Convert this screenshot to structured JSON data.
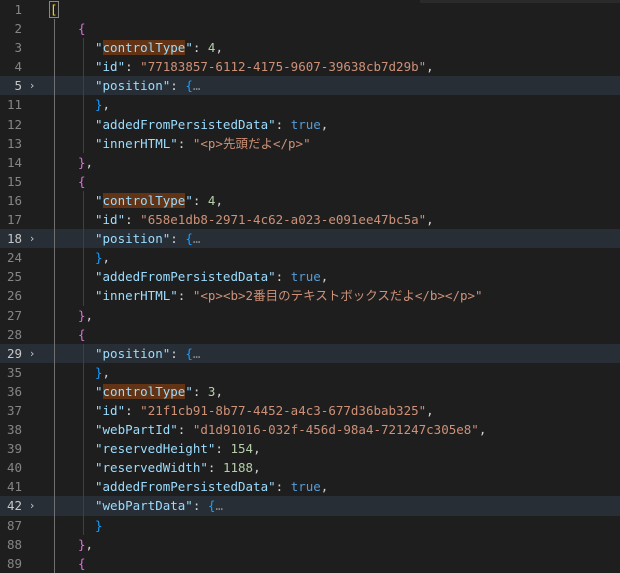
{
  "editor": {
    "lines": [
      {
        "num": "1",
        "fold": "",
        "hl": false,
        "indent": 0,
        "toks": [
          {
            "c": "br1 match",
            "t": "["
          }
        ]
      },
      {
        "num": "2",
        "fold": "",
        "hl": false,
        "indent": 1,
        "toks": [
          {
            "c": "br2",
            "t": "{"
          }
        ]
      },
      {
        "num": "3",
        "fold": "",
        "hl": false,
        "indent": 2,
        "toks": [
          {
            "c": "k",
            "t": "\""
          },
          {
            "c": "k wordhl",
            "t": "controlType"
          },
          {
            "c": "k",
            "t": "\""
          },
          {
            "c": "p",
            "t": ": "
          },
          {
            "c": "n",
            "t": "4"
          },
          {
            "c": "p",
            "t": ","
          }
        ]
      },
      {
        "num": "4",
        "fold": "",
        "hl": false,
        "indent": 2,
        "toks": [
          {
            "c": "k",
            "t": "\"id\""
          },
          {
            "c": "p",
            "t": ": "
          },
          {
            "c": "s",
            "t": "\"77183857-6112-4175-9607-39638cb7d29b\""
          },
          {
            "c": "p",
            "t": ","
          }
        ]
      },
      {
        "num": "5",
        "fold": "›",
        "hl": true,
        "indent": 2,
        "toks": [
          {
            "c": "k",
            "t": "\"position\""
          },
          {
            "c": "p",
            "t": ": "
          },
          {
            "c": "br3",
            "t": "{"
          },
          {
            "c": "ell",
            "t": "…"
          }
        ]
      },
      {
        "num": "11",
        "fold": "",
        "hl": false,
        "indent": 2,
        "toks": [
          {
            "c": "br3",
            "t": "}"
          },
          {
            "c": "p",
            "t": ","
          }
        ]
      },
      {
        "num": "12",
        "fold": "",
        "hl": false,
        "indent": 2,
        "toks": [
          {
            "c": "k",
            "t": "\"addedFromPersistedData\""
          },
          {
            "c": "p",
            "t": ": "
          },
          {
            "c": "b",
            "t": "true"
          },
          {
            "c": "p",
            "t": ","
          }
        ]
      },
      {
        "num": "13",
        "fold": "",
        "hl": false,
        "indent": 2,
        "toks": [
          {
            "c": "k",
            "t": "\"innerHTML\""
          },
          {
            "c": "p",
            "t": ": "
          },
          {
            "c": "s",
            "t": "\"<p>先頭だよ</p>\""
          }
        ]
      },
      {
        "num": "14",
        "fold": "",
        "hl": false,
        "indent": 1,
        "toks": [
          {
            "c": "br2",
            "t": "}"
          },
          {
            "c": "p",
            "t": ","
          }
        ]
      },
      {
        "num": "15",
        "fold": "",
        "hl": false,
        "indent": 1,
        "toks": [
          {
            "c": "br2",
            "t": "{"
          }
        ]
      },
      {
        "num": "16",
        "fold": "",
        "hl": false,
        "indent": 2,
        "toks": [
          {
            "c": "k",
            "t": "\""
          },
          {
            "c": "k wordhl",
            "t": "controlType"
          },
          {
            "c": "k",
            "t": "\""
          },
          {
            "c": "p",
            "t": ": "
          },
          {
            "c": "n",
            "t": "4"
          },
          {
            "c": "p",
            "t": ","
          }
        ]
      },
      {
        "num": "17",
        "fold": "",
        "hl": false,
        "indent": 2,
        "toks": [
          {
            "c": "k",
            "t": "\"id\""
          },
          {
            "c": "p",
            "t": ": "
          },
          {
            "c": "s",
            "t": "\"658e1db8-2971-4c62-a023-e091ee47bc5a\""
          },
          {
            "c": "p",
            "t": ","
          }
        ]
      },
      {
        "num": "18",
        "fold": "›",
        "hl": true,
        "indent": 2,
        "toks": [
          {
            "c": "k",
            "t": "\"position\""
          },
          {
            "c": "p",
            "t": ": "
          },
          {
            "c": "br3",
            "t": "{"
          },
          {
            "c": "ell",
            "t": "…"
          }
        ]
      },
      {
        "num": "24",
        "fold": "",
        "hl": false,
        "indent": 2,
        "toks": [
          {
            "c": "br3",
            "t": "}"
          },
          {
            "c": "p",
            "t": ","
          }
        ]
      },
      {
        "num": "25",
        "fold": "",
        "hl": false,
        "indent": 2,
        "toks": [
          {
            "c": "k",
            "t": "\"addedFromPersistedData\""
          },
          {
            "c": "p",
            "t": ": "
          },
          {
            "c": "b",
            "t": "true"
          },
          {
            "c": "p",
            "t": ","
          }
        ]
      },
      {
        "num": "26",
        "fold": "",
        "hl": false,
        "indent": 2,
        "toks": [
          {
            "c": "k",
            "t": "\"innerHTML\""
          },
          {
            "c": "p",
            "t": ": "
          },
          {
            "c": "s",
            "t": "\"<p><b>2番目のテキストボックスだよ</b></p>\""
          }
        ]
      },
      {
        "num": "27",
        "fold": "",
        "hl": false,
        "indent": 1,
        "toks": [
          {
            "c": "br2",
            "t": "}"
          },
          {
            "c": "p",
            "t": ","
          }
        ]
      },
      {
        "num": "28",
        "fold": "",
        "hl": false,
        "indent": 1,
        "toks": [
          {
            "c": "br2",
            "t": "{"
          }
        ]
      },
      {
        "num": "29",
        "fold": "›",
        "hl": true,
        "indent": 2,
        "toks": [
          {
            "c": "k",
            "t": "\"position\""
          },
          {
            "c": "p",
            "t": ": "
          },
          {
            "c": "br3",
            "t": "{"
          },
          {
            "c": "ell",
            "t": "…"
          }
        ]
      },
      {
        "num": "35",
        "fold": "",
        "hl": false,
        "indent": 2,
        "toks": [
          {
            "c": "br3",
            "t": "}"
          },
          {
            "c": "p",
            "t": ","
          }
        ]
      },
      {
        "num": "36",
        "fold": "",
        "hl": false,
        "indent": 2,
        "toks": [
          {
            "c": "k",
            "t": "\""
          },
          {
            "c": "k wordhl",
            "t": "controlType"
          },
          {
            "c": "k",
            "t": "\""
          },
          {
            "c": "p",
            "t": ": "
          },
          {
            "c": "n",
            "t": "3"
          },
          {
            "c": "p",
            "t": ","
          }
        ]
      },
      {
        "num": "37",
        "fold": "",
        "hl": false,
        "indent": 2,
        "toks": [
          {
            "c": "k",
            "t": "\"id\""
          },
          {
            "c": "p",
            "t": ": "
          },
          {
            "c": "s",
            "t": "\"21f1cb91-8b77-4452-a4c3-677d36bab325\""
          },
          {
            "c": "p",
            "t": ","
          }
        ]
      },
      {
        "num": "38",
        "fold": "",
        "hl": false,
        "indent": 2,
        "toks": [
          {
            "c": "k",
            "t": "\"webPartId\""
          },
          {
            "c": "p",
            "t": ": "
          },
          {
            "c": "s",
            "t": "\"d1d91016-032f-456d-98a4-721247c305e8\""
          },
          {
            "c": "p",
            "t": ","
          }
        ]
      },
      {
        "num": "39",
        "fold": "",
        "hl": false,
        "indent": 2,
        "toks": [
          {
            "c": "k",
            "t": "\"reservedHeight\""
          },
          {
            "c": "p",
            "t": ": "
          },
          {
            "c": "n",
            "t": "154"
          },
          {
            "c": "p",
            "t": ","
          }
        ]
      },
      {
        "num": "40",
        "fold": "",
        "hl": false,
        "indent": 2,
        "toks": [
          {
            "c": "k",
            "t": "\"reservedWidth\""
          },
          {
            "c": "p",
            "t": ": "
          },
          {
            "c": "n",
            "t": "1188"
          },
          {
            "c": "p",
            "t": ","
          }
        ]
      },
      {
        "num": "41",
        "fold": "",
        "hl": false,
        "indent": 2,
        "toks": [
          {
            "c": "k",
            "t": "\"addedFromPersistedData\""
          },
          {
            "c": "p",
            "t": ": "
          },
          {
            "c": "b",
            "t": "true"
          },
          {
            "c": "p",
            "t": ","
          }
        ]
      },
      {
        "num": "42",
        "fold": "›",
        "hl": true,
        "indent": 2,
        "toks": [
          {
            "c": "k",
            "t": "\"webPartData\""
          },
          {
            "c": "p",
            "t": ": "
          },
          {
            "c": "br3",
            "t": "{"
          },
          {
            "c": "ell",
            "t": "…"
          }
        ]
      },
      {
        "num": "87",
        "fold": "",
        "hl": false,
        "indent": 2,
        "toks": [
          {
            "c": "br3",
            "t": "}"
          }
        ]
      },
      {
        "num": "88",
        "fold": "",
        "hl": false,
        "indent": 1,
        "toks": [
          {
            "c": "br2",
            "t": "}"
          },
          {
            "c": "p",
            "t": ","
          }
        ]
      },
      {
        "num": "89",
        "fold": "",
        "hl": false,
        "indent": 1,
        "toks": [
          {
            "c": "br2",
            "t": "{"
          }
        ]
      }
    ]
  }
}
